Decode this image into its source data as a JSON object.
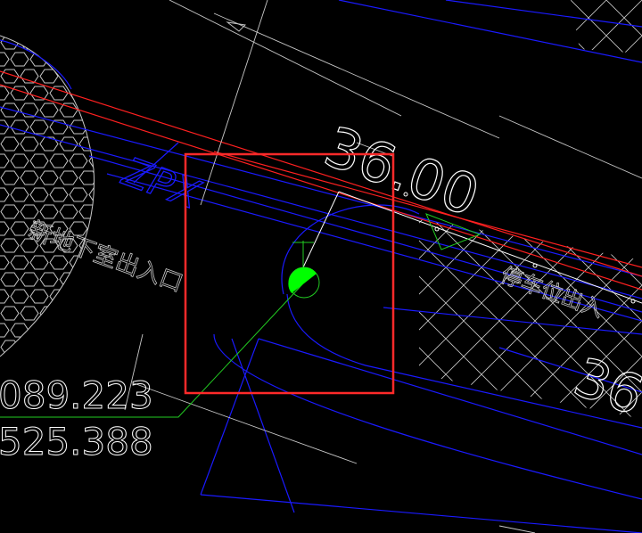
{
  "canvas": {
    "background": "#000000"
  },
  "colors": {
    "white": "#ffffff",
    "gray": "#c8c8c8",
    "blue": "#1a1aff",
    "red": "#ff2020",
    "green": "#22cc22",
    "bright_green": "#00ff00",
    "selection": "#ff2a2a"
  },
  "labels": {
    "elevation_large": "36.00",
    "elevation_partial": "36",
    "pipe_code": "ZPX",
    "area_note_left": "新地下室出入口",
    "area_note_right": "停车位出入",
    "coord_x": "089.223",
    "coord_y": "525.388"
  },
  "selection": {
    "description": "selected-object-window"
  },
  "symbol": {
    "icon": "valve-node-icon"
  }
}
